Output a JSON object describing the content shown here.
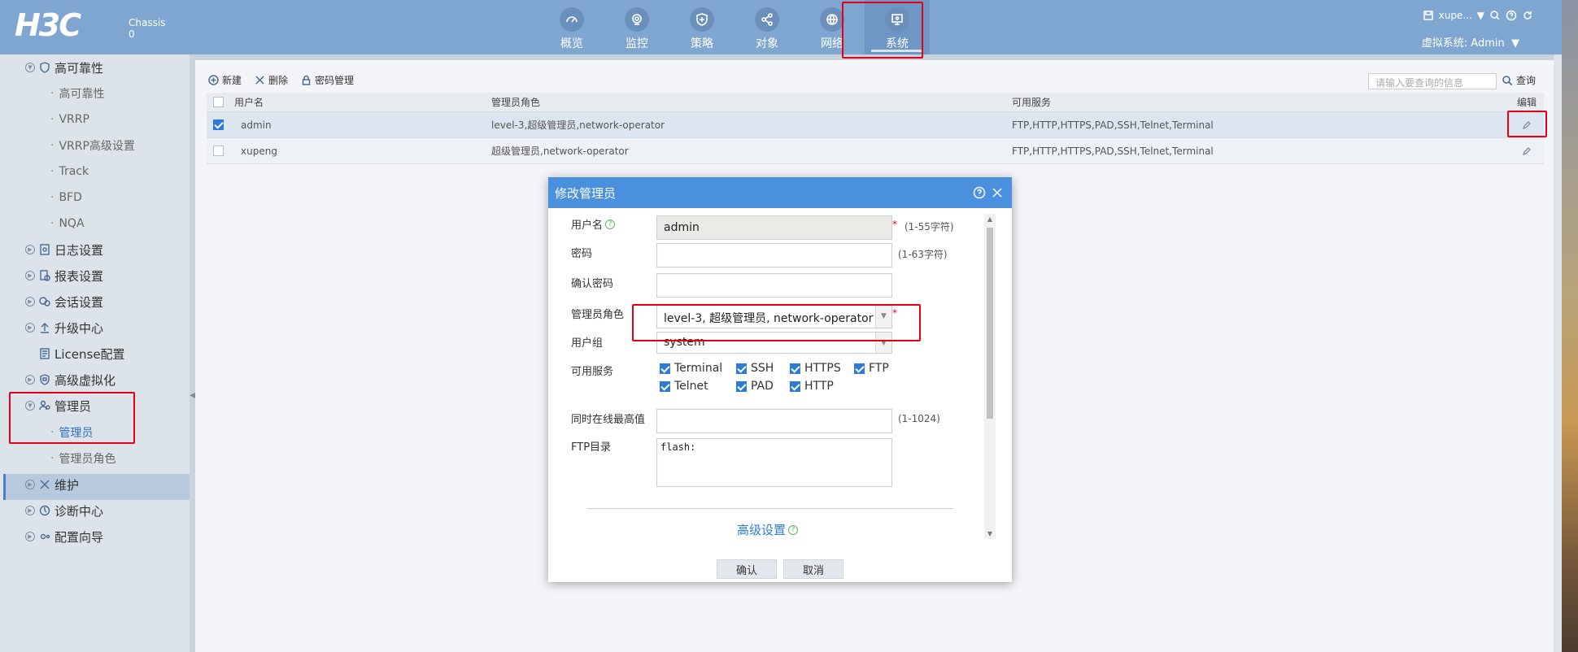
{
  "header": {
    "logo": "H3C",
    "chassis_label": "Chassis",
    "chassis_num": "0",
    "nav": [
      {
        "label": "概览",
        "icon": "gauge-icon"
      },
      {
        "label": "监控",
        "icon": "camera-icon"
      },
      {
        "label": "策略",
        "icon": "shield-icon"
      },
      {
        "label": "对象",
        "icon": "share-icon"
      },
      {
        "label": "网络",
        "icon": "globe-icon"
      },
      {
        "label": "系统",
        "icon": "monitor-icon",
        "active": true
      }
    ],
    "user": "xupe...",
    "virtual_system": "虚拟系统: Admin"
  },
  "sidebar": {
    "items": [
      {
        "label": "高可靠性",
        "type": "group"
      },
      {
        "label": "高可靠性",
        "type": "sub"
      },
      {
        "label": "VRRP",
        "type": "sub"
      },
      {
        "label": "VRRP高级设置",
        "type": "sub"
      },
      {
        "label": "Track",
        "type": "sub"
      },
      {
        "label": "BFD",
        "type": "sub"
      },
      {
        "label": "NQA",
        "type": "sub"
      },
      {
        "label": "日志设置",
        "type": "group"
      },
      {
        "label": "报表设置",
        "type": "group"
      },
      {
        "label": "会话设置",
        "type": "group"
      },
      {
        "label": "升级中心",
        "type": "group"
      },
      {
        "label": "License配置",
        "type": "group"
      },
      {
        "label": "高级虚拟化",
        "type": "group"
      },
      {
        "label": "管理员",
        "type": "group"
      },
      {
        "label": "管理员",
        "type": "sub",
        "active": true
      },
      {
        "label": "管理员角色",
        "type": "sub"
      },
      {
        "label": "维护",
        "type": "group"
      },
      {
        "label": "诊断中心",
        "type": "group"
      },
      {
        "label": "配置向导",
        "type": "group"
      }
    ]
  },
  "toolbar": {
    "new_label": "新建",
    "delete_label": "删除",
    "password_label": "密码管理",
    "search_placeholder": "请输入要查询的信息",
    "search_label": "查询"
  },
  "table": {
    "headers": [
      "用户名",
      "管理员角色",
      "可用服务",
      "编辑"
    ],
    "rows": [
      {
        "checked": true,
        "user": "admin",
        "role": "level-3,超级管理员,network-operator",
        "services": "FTP,HTTP,HTTPS,PAD,SSH,Telnet,Terminal"
      },
      {
        "checked": false,
        "user": "xupeng",
        "role": "超级管理员,network-operator",
        "services": "FTP,HTTP,HTTPS,PAD,SSH,Telnet,Terminal"
      }
    ]
  },
  "modal": {
    "title": "修改管理员",
    "username_label": "用户名",
    "username_value": "admin",
    "username_hint": "(1-55字符)",
    "password_label": "密码",
    "password_hint": "(1-63字符)",
    "confirm_label": "确认密码",
    "role_label": "管理员角色",
    "role_value": "level-3, 超级管理员, network-operator",
    "group_label": "用户组",
    "group_value": "system",
    "services_label": "可用服务",
    "services": [
      "Terminal",
      "SSH",
      "HTTPS",
      "FTP",
      "Telnet",
      "PAD",
      "HTTP"
    ],
    "max_online_label": "同时在线最高值",
    "max_online_hint": "(1-1024)",
    "ftp_label": "FTP目录",
    "ftp_value": "flash:",
    "advanced_label": "高级设置",
    "ok_label": "确认",
    "cancel_label": "取消",
    "required_mark": "*"
  },
  "colors": {
    "header_bg": "#7fa6d1",
    "modal_header": "#4a90dc",
    "highlight": "#e60012",
    "checkbox": "#2e7bd6"
  }
}
